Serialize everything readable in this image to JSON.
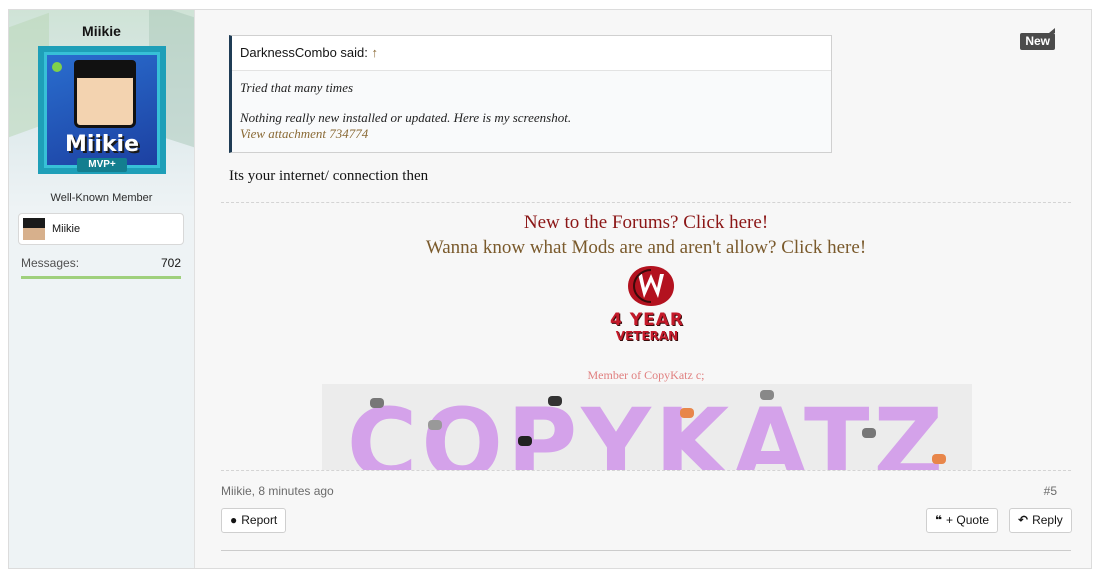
{
  "user": {
    "name": "Miikie",
    "avatar_name": "Miikie",
    "avatar_rank": "MVP+",
    "title": "Well-Known Member",
    "minecraft_name": "Miikie",
    "messages_label": "Messages:",
    "messages_count": "702"
  },
  "badge": {
    "new_label": "New"
  },
  "quote": {
    "author_line": "DarknessCombo said:",
    "jump_arrow": "↑",
    "line1": "Tried that many times",
    "line2": "Nothing really new installed or updated. Here is my screenshot.",
    "attachment_link": "View attachment 734774"
  },
  "reply": {
    "text": "Its your internet/ connection then"
  },
  "signature": {
    "line1": "New to the Forums? Click here!",
    "line2": "Wanna know what Mods are and aren't allow? Click here!",
    "veteran_line1": "4 YEAR",
    "veteran_line2": "VETERAN",
    "member_of": "Member of CopyKatz c;",
    "banner_word": "COPYKATZ"
  },
  "footer": {
    "meta": "Miikie, 8 minutes ago",
    "post_number": "#5",
    "report_label": "Report",
    "quote_label": "+ Quote",
    "reply_label": "Reply"
  },
  "icons": {
    "report": "exclamation-circle-icon",
    "quote": "quote-icon",
    "reply": "reply-arrow-icon"
  },
  "colors": {
    "signature_link_red": "#8b1616",
    "signature_link_brown": "#7a5a2c",
    "quote_border": "#1f3c55",
    "messages_bar": "#9fd07c",
    "banner_text": "#d4a2ea"
  }
}
